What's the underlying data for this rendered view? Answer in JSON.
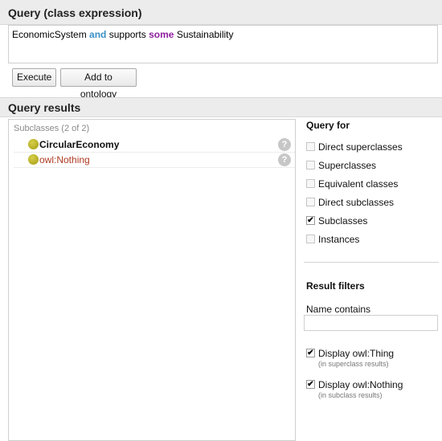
{
  "query_section": {
    "title": "Query (class expression)",
    "expression": {
      "part1": "EconomicSystem",
      "kw1": "and",
      "part2": "supports",
      "kw2": "some",
      "part3": "Sustainability"
    },
    "execute_label": "Execute",
    "add_label": "Add to ontology"
  },
  "results_section": {
    "title": "Query results",
    "caption": "Subclasses (2 of 2)",
    "rows": [
      {
        "label": "CircularEconomy",
        "help": "?"
      },
      {
        "label": "owl:Nothing",
        "help": "?"
      }
    ]
  },
  "query_for": {
    "title": "Query for",
    "options": [
      {
        "label": "Direct superclasses",
        "checked": false
      },
      {
        "label": "Superclasses",
        "checked": false
      },
      {
        "label": "Equivalent classes",
        "checked": false
      },
      {
        "label": "Direct subclasses",
        "checked": false
      },
      {
        "label": "Subclasses",
        "checked": true
      },
      {
        "label": "Instances",
        "checked": false
      }
    ]
  },
  "result_filters": {
    "title": "Result filters",
    "name_contains_label": "Name contains",
    "name_contains_value": "",
    "options": [
      {
        "label": "Display owl:Thing",
        "sub": "(in superclass results)",
        "checked": true
      },
      {
        "label": "Display owl:Nothing",
        "sub": "(in subclass results)",
        "checked": true
      }
    ]
  },
  "check_glyph": "✔"
}
